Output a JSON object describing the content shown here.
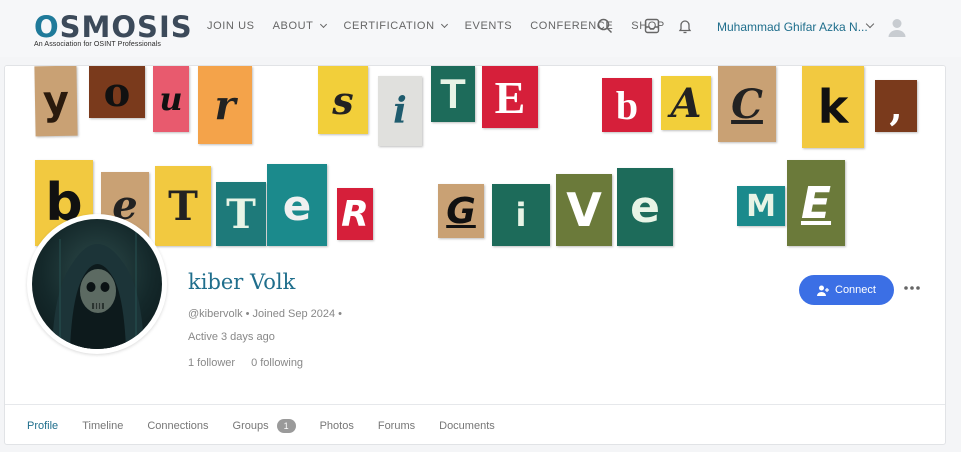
{
  "header": {
    "logo_text": "OSMOSIS",
    "logo_tagline": "An Association for OSINT Professionals",
    "nav": [
      {
        "label": "JOIN US",
        "dropdown": false
      },
      {
        "label": "ABOUT",
        "dropdown": true
      },
      {
        "label": "CERTIFICATION",
        "dropdown": true
      },
      {
        "label": "EVENTS",
        "dropdown": false
      },
      {
        "label": "CONFERENCE",
        "dropdown": false
      },
      {
        "label": "SHOP",
        "dropdown": false
      }
    ],
    "icons": [
      "search-icon",
      "inbox-icon",
      "bell-icon"
    ],
    "user_name": "Muhammad Ghifar Azka N..."
  },
  "cover": {
    "line1": [
      "y",
      "o",
      "u",
      "r",
      "s",
      "i",
      "T",
      "E",
      "b",
      "A",
      "C",
      "k",
      ","
    ],
    "line2": [
      "b",
      "e",
      "T",
      "T",
      "e",
      "R",
      "G",
      "i",
      "V",
      "e",
      "M",
      "E"
    ]
  },
  "profile": {
    "name": "kiber Volk",
    "meta": "@kibervolk • Joined Sep 2024 •",
    "active": "Active 3 days ago",
    "followers": "1 follower",
    "following": "0 following",
    "connect_label": "Connect"
  },
  "tabs": [
    {
      "label": "Profile",
      "active": true
    },
    {
      "label": "Timeline"
    },
    {
      "label": "Connections"
    },
    {
      "label": "Groups",
      "badge": "1"
    },
    {
      "label": "Photos"
    },
    {
      "label": "Forums"
    },
    {
      "label": "Documents"
    }
  ],
  "colors": {
    "accent": "#1f6e8c",
    "button": "#3b6fe5"
  }
}
